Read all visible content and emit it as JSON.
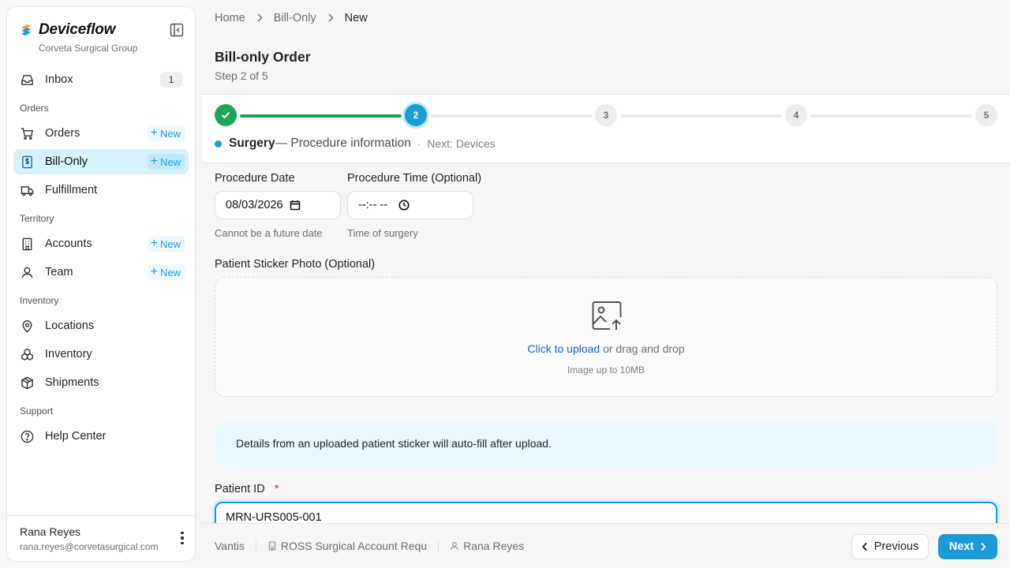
{
  "app": {
    "name": "Deviceflow",
    "org": "Corveta Surgical Group"
  },
  "sidebar": {
    "inbox": {
      "label": "Inbox",
      "count": "1"
    },
    "sections": {
      "orders": "Orders",
      "territory": "Territory",
      "inventory": "Inventory",
      "support": "Support"
    },
    "items": {
      "orders": {
        "label": "Orders",
        "new": "New"
      },
      "bill_only": {
        "label": "Bill-Only",
        "new": "New"
      },
      "fulfillment": {
        "label": "Fulfillment"
      },
      "accounts": {
        "label": "Accounts",
        "new": "New"
      },
      "team": {
        "label": "Team",
        "new": "New"
      },
      "locations": {
        "label": "Locations"
      },
      "inventory": {
        "label": "Inventory"
      },
      "shipments": {
        "label": "Shipments"
      },
      "help": {
        "label": "Help Center"
      }
    },
    "user": {
      "name": "Rana Reyes",
      "email": "rana.reyes@corvetasurgical.com"
    }
  },
  "breadcrumb": [
    "Home",
    "Bill-Only",
    "New"
  ],
  "page": {
    "title": "Bill-only Order",
    "step": "Step 2 of 5"
  },
  "stepper": {
    "steps": [
      "1",
      "2",
      "3",
      "4",
      "5"
    ],
    "current_name": "Surgery",
    "current_desc": "— Procedure information",
    "separator": "·",
    "next": "Next: Devices"
  },
  "form": {
    "procedure_date": {
      "label": "Procedure Date",
      "value": "08/03/2026",
      "help": "Cannot be a future date"
    },
    "procedure_time": {
      "label": "Procedure Time (Optional)",
      "value": "--:-- --",
      "help": "Time of surgery"
    },
    "sticker": {
      "label": "Patient Sticker Photo (Optional)",
      "link": "Click to upload",
      "rest": " or drag and drop",
      "limit": "Image up to 10MB"
    },
    "info": "Details from an uploaded patient sticker will auto-fill after upload.",
    "patient_id": {
      "label": "Patient ID",
      "required": "*",
      "value": "MRN-URS005-001"
    }
  },
  "footer": {
    "vendor": "Vantis",
    "account": "ROSS Surgical Account Requ",
    "user": "Rana Reyes",
    "prev": "Previous",
    "next": "Next"
  },
  "colors": {
    "accent": "#1a9bd7",
    "success": "#1ea35a",
    "active_bg": "#d6f2fc",
    "link": "#1a5fd7"
  }
}
